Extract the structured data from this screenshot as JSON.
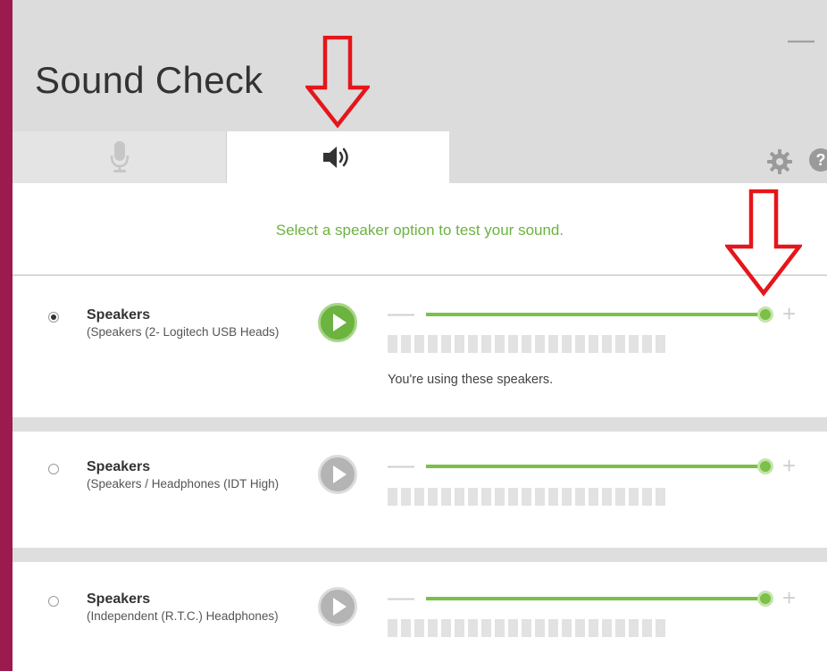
{
  "window": {
    "title": "Sound Check",
    "minimize_glyph": "—"
  },
  "tabs": [
    {
      "name": "microphone",
      "icon": "microphone-icon",
      "selected": false
    },
    {
      "name": "speakers",
      "icon": "speaker-icon",
      "selected": true
    }
  ],
  "header_icons": {
    "settings": "gear-icon",
    "help": "?"
  },
  "instruction": "Select a speaker option to test your sound.",
  "devices": [
    {
      "name": "Speakers",
      "detail": "(Speakers (2- Logitech USB Heads)",
      "selected": true,
      "volume_fraction": 1.0,
      "status": "You're using these speakers."
    },
    {
      "name": "Speakers",
      "detail": "(Speakers / Headphones (IDT High)",
      "selected": false,
      "volume_fraction": 1.0
    },
    {
      "name": "Speakers",
      "detail": "(Independent (R.T.C.) Headphones)",
      "selected": false,
      "volume_fraction": 1.0
    }
  ],
  "volume_controls": {
    "minus": "—",
    "plus": "+"
  },
  "colors": {
    "accent_green": "#6cb33f",
    "arrow_red": "#e5161b",
    "background": "#9b1b4e"
  }
}
